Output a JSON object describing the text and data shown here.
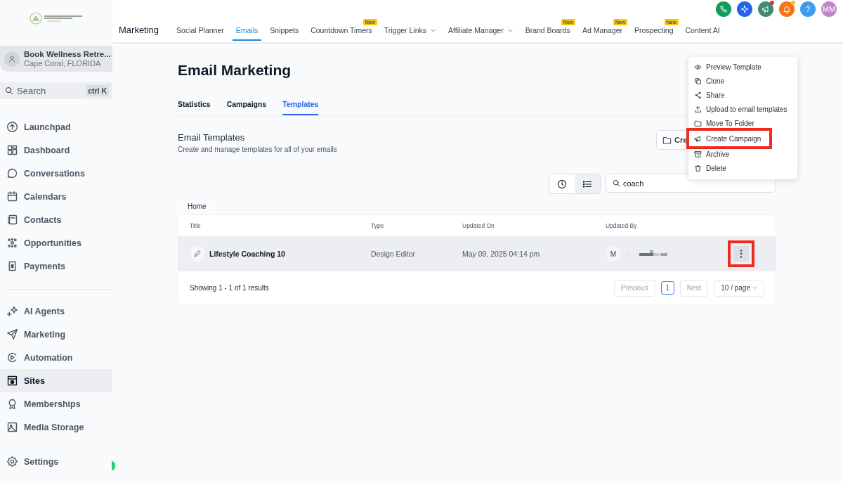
{
  "sidebar": {
    "location": {
      "name": "Book Wellness Retre...",
      "place": "Cape Coral, FLORIDA"
    },
    "search": {
      "placeholder": "Search",
      "shortcut": "ctrl K"
    },
    "groups": [
      [
        {
          "label": "Launchpad",
          "selected": false
        },
        {
          "label": "Dashboard",
          "selected": false
        },
        {
          "label": "Conversations",
          "selected": false
        },
        {
          "label": "Calendars",
          "selected": false
        },
        {
          "label": "Contacts",
          "selected": false
        },
        {
          "label": "Opportunities",
          "selected": false
        },
        {
          "label": "Payments",
          "selected": false
        }
      ],
      [
        {
          "label": "AI Agents",
          "selected": false
        },
        {
          "label": "Marketing",
          "selected": false
        },
        {
          "label": "Automation",
          "selected": false
        },
        {
          "label": "Sites",
          "selected": true
        },
        {
          "label": "Memberships",
          "selected": false
        },
        {
          "label": "Media Storage",
          "selected": false
        }
      ]
    ],
    "settings": {
      "label": "Settings"
    }
  },
  "topbar": {
    "section": "Marketing",
    "tabs": [
      {
        "label": "Social Planner",
        "selected": false,
        "dropdown": false
      },
      {
        "label": "Emails",
        "selected": true,
        "dropdown": false
      },
      {
        "label": "Snippets",
        "selected": false,
        "dropdown": false
      },
      {
        "label": "Countdown Timers",
        "selected": false,
        "dropdown": false,
        "badge": "New"
      },
      {
        "label": "Trigger Links",
        "selected": false,
        "dropdown": true
      },
      {
        "label": "Affiliate Manager",
        "selected": false,
        "dropdown": true
      },
      {
        "label": "Brand Boards",
        "selected": false,
        "dropdown": false,
        "badge": "New"
      },
      {
        "label": "Ad Manager",
        "selected": false,
        "dropdown": false,
        "badge": "New"
      },
      {
        "label": "Prospecting",
        "selected": false,
        "dropdown": false,
        "badge": "New"
      },
      {
        "label": "Content AI",
        "selected": false,
        "dropdown": false
      }
    ],
    "actions": [
      {
        "kind": "phone",
        "color": "#0f9d58",
        "notify": false
      },
      {
        "kind": "sparkle",
        "color": "#2563eb",
        "notify": false
      },
      {
        "kind": "megaphone",
        "color": "#3f8a72",
        "notify": true
      },
      {
        "kind": "bell",
        "color": "#f97316",
        "notify": true
      },
      {
        "kind": "help",
        "color": "#3b9cf0",
        "notify": false,
        "text": "?"
      },
      {
        "kind": "avatar",
        "color": "#c084c8",
        "notify": false,
        "text": "MM"
      }
    ]
  },
  "page": {
    "title": "Email Marketing",
    "tabs": [
      {
        "label": "Statistics",
        "selected": false
      },
      {
        "label": "Campaigns",
        "selected": false
      },
      {
        "label": "Templates",
        "selected": true
      }
    ],
    "section_title": "Email Templates",
    "section_subtitle": "Create and manage templates for all of your emails",
    "create_button": "Cre",
    "view_toggle": [
      {
        "kind": "clock",
        "selected": false
      },
      {
        "kind": "list",
        "selected": true
      }
    ],
    "search": {
      "value": "coach"
    },
    "breadcrumb": "Home",
    "table": {
      "columns": [
        "Title",
        "Type",
        "Updated On",
        "Updated By"
      ],
      "rows": [
        {
          "title": "Lifestyle Coaching 10",
          "type": "Design Editor",
          "updated_on": "May 09, 2025 04:14 pm",
          "avatar": "M",
          "selected": true,
          "action_highlighted": true
        }
      ]
    },
    "pagination": {
      "summary": "Showing 1 - 1 of 1 results",
      "previous": {
        "label": "Previous",
        "disabled": true
      },
      "pages": [
        {
          "label": "1",
          "selected": true
        }
      ],
      "next": {
        "label": "Next",
        "disabled": true
      },
      "page_size": "10 / page"
    }
  },
  "context_menu": {
    "items": [
      {
        "kind": "eye",
        "label": "Preview Template",
        "highlighted": false
      },
      {
        "kind": "copy",
        "label": "Clone",
        "highlighted": false
      },
      {
        "kind": "share",
        "label": "Share",
        "highlighted": false
      },
      {
        "kind": "upload",
        "label": "Upload to email templates",
        "highlighted": false
      },
      {
        "kind": "folder",
        "label": "Move To Folder",
        "highlighted": false
      },
      {
        "kind": "megaphone",
        "label": "Create Campaign",
        "highlighted": true
      },
      {
        "kind": "archive",
        "label": "Archive",
        "highlighted": false
      },
      {
        "kind": "trash",
        "label": "Delete",
        "highlighted": false
      }
    ]
  }
}
